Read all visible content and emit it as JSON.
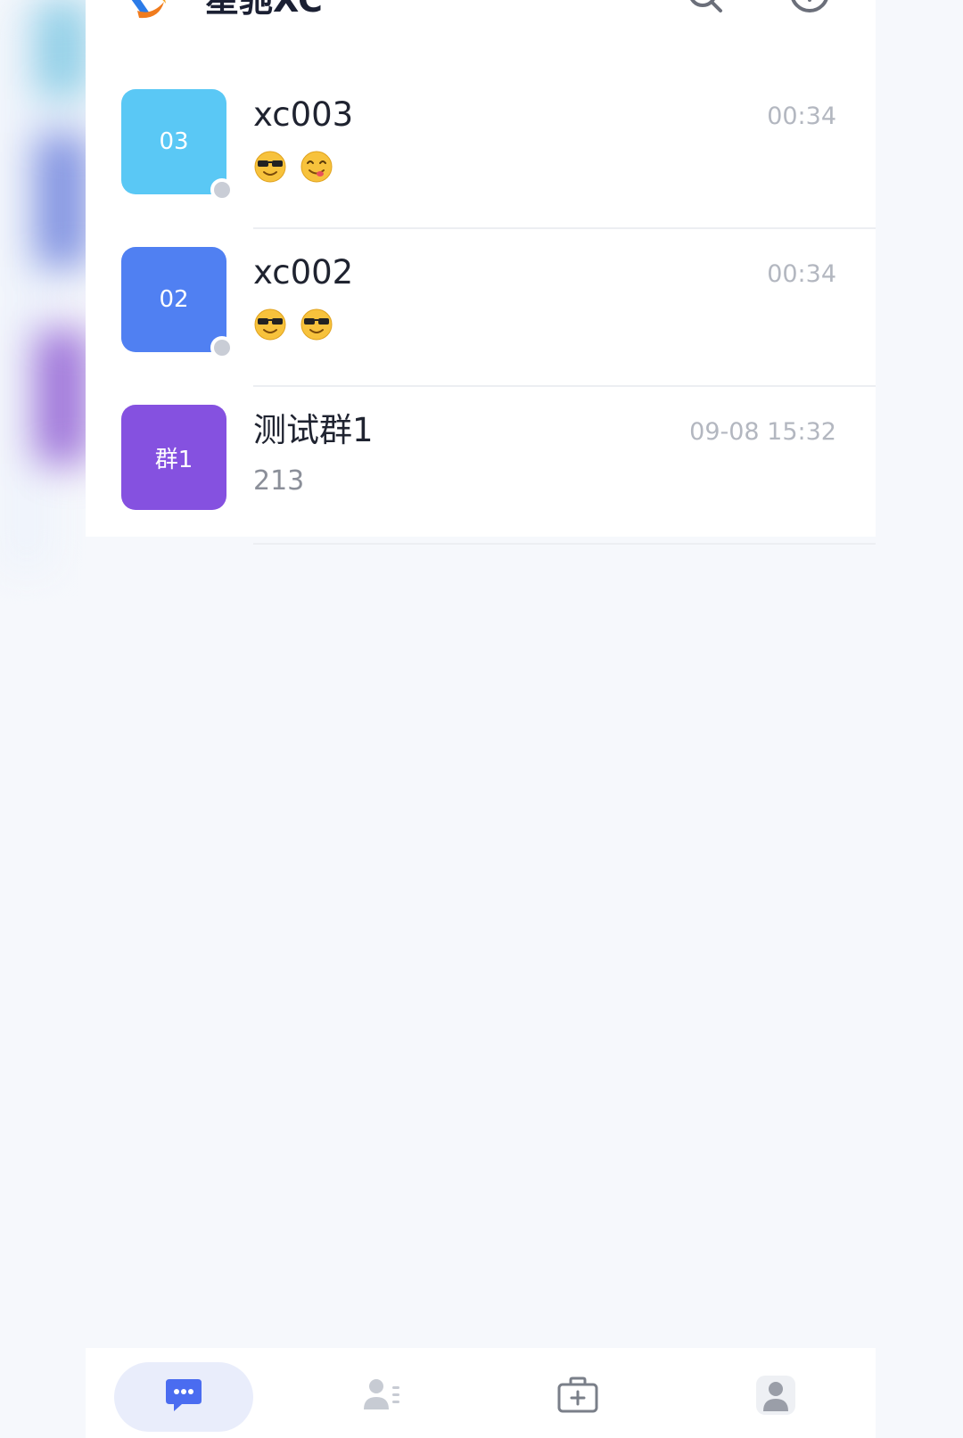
{
  "app": {
    "title": "星驰XC",
    "logo_icon": "app-logo-icon"
  },
  "header": {
    "search_icon": "search-icon",
    "add_icon": "plus-circle-icon"
  },
  "conversations": [
    {
      "name": "xc003",
      "avatar_text": "03",
      "avatar_color": "#5ac8f5",
      "time": "00:34",
      "preview_text": "",
      "preview_emojis": [
        "sunglasses-emoji",
        "yum-emoji"
      ],
      "online_status": "offline"
    },
    {
      "name": "xc002",
      "avatar_text": "02",
      "avatar_color": "#5080f2",
      "time": "00:34",
      "preview_text": "",
      "preview_emojis": [
        "sunglasses-emoji",
        "sunglasses-emoji"
      ],
      "online_status": "offline"
    },
    {
      "name": "测试群1",
      "avatar_text": "群1",
      "avatar_color": "#8551e0",
      "time": "09-08 15:32",
      "preview_text": "213",
      "preview_emojis": [],
      "online_status": null
    }
  ],
  "tabbar": {
    "tabs": [
      {
        "id": "chat",
        "icon": "chat-bubble-icon",
        "active": true
      },
      {
        "id": "contacts",
        "icon": "contacts-icon",
        "active": false
      },
      {
        "id": "workbench",
        "icon": "medical-kit-icon",
        "active": false
      },
      {
        "id": "profile",
        "icon": "user-icon",
        "active": false
      }
    ]
  },
  "colors": {
    "accent": "#4a6cf0",
    "page_background": "#f6f8fc",
    "time_text": "#b3b7c0",
    "status_dot": "#c9cdd6"
  }
}
